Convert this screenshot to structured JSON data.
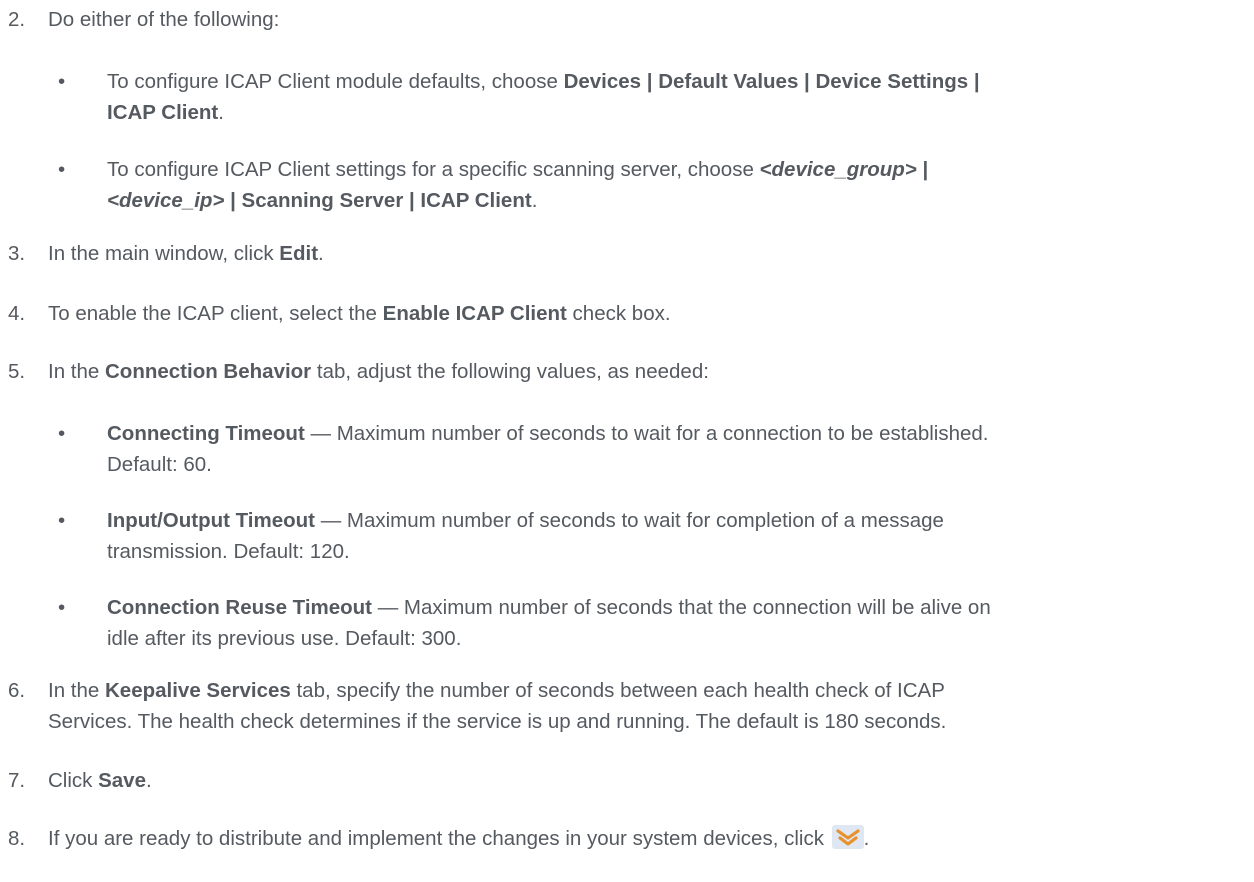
{
  "steps": [
    {
      "num": "2.",
      "pre": "Do either of the following:"
    },
    {
      "num": "3.",
      "pre": "In the main window, click ",
      "bold": "Edit",
      "post": "."
    },
    {
      "num": "4.",
      "pre": "To enable the ICAP client, select the ",
      "bold": "Enable ICAP Client",
      "post": " check box."
    },
    {
      "num": "5.",
      "pre": "In the ",
      "bold": "Connection Behavior",
      "post": " tab, adjust the following values, as needed:"
    },
    {
      "num": "6.",
      "pre": "In the ",
      "bold": "Keepalive Services",
      "post": " tab, specify the number of seconds between each health check of ICAP",
      "line2": "Services. The health check determines if the service is up and running. The default is 180 seconds."
    },
    {
      "num": "7.",
      "pre": "Click ",
      "bold": "Save",
      "post": "."
    },
    {
      "num": "8.",
      "pre": "If you are ready to distribute and implement the changes in your system devices, click ",
      "post": "."
    }
  ],
  "step2_bullets": [
    {
      "dot": "•",
      "line1_pre": "To configure ICAP Client module defaults, choose ",
      "line1_bold": "Devices | Default Values | Device Settings |",
      "line2_bold": "ICAP Client",
      "line2_post": "."
    },
    {
      "dot": "•",
      "line1_pre": "To configure ICAP Client settings for a specific scanning server, choose ",
      "line1_bi": "<device_group>",
      "line1_bold": " |",
      "line2_bi": "<device_ip>",
      "line2_bold": " | Scanning Server | ICAP Client",
      "line2_post": "."
    }
  ],
  "step5_bullets": [
    {
      "dot": "•",
      "bold": "Connecting Timeout",
      "line1_post": " — Maximum number of seconds to wait for a connection to be established.",
      "line2": "Default: 60."
    },
    {
      "dot": "•",
      "bold": "Input/Output Timeout",
      "line1_post": " — Maximum number of seconds to wait for completion of a message",
      "line2": "transmission. Default: 120."
    },
    {
      "dot": "•",
      "bold": "Connection Reuse Timeout",
      "line1_post": " — Maximum number of seconds that the connection will be alive on",
      "line2": "idle after its previous use. Default: 300."
    }
  ],
  "icons": {
    "distribute": "distribute-changes-icon"
  },
  "colors": {
    "text": "#555a60",
    "icon_bg": "#dfe7f2",
    "icon_orange": "#e8922e"
  }
}
